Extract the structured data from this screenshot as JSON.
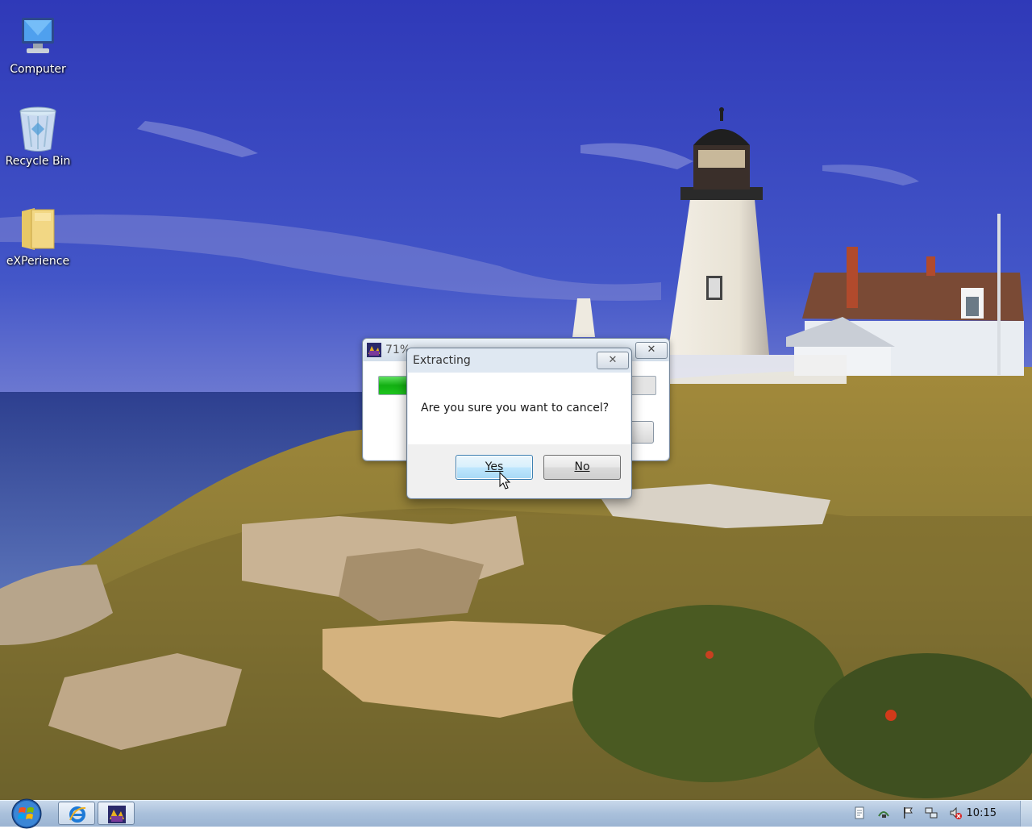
{
  "desktop": {
    "icons": [
      {
        "label": "Computer",
        "icon": "computer-icon"
      },
      {
        "label": "Recycle Bin",
        "icon": "recycle-bin-icon"
      },
      {
        "label": "eXPerience",
        "icon": "folder-icon"
      }
    ]
  },
  "progress_window": {
    "title": "71% ",
    "progress_fraction": 0.71,
    "close_symbol": "✕"
  },
  "confirm_dialog": {
    "title": "Extracting",
    "close_symbol": "✕",
    "message": "Are you sure you want to cancel?",
    "yes_label": "Yes",
    "no_label": "No"
  },
  "taskbar": {
    "start_icon": "windows-start-orb-icon",
    "pinned": [
      {
        "name": "internet-explorer-icon"
      },
      {
        "name": "extractor-app-icon"
      }
    ],
    "tray_icons": [
      "document-icon",
      "network-icon",
      "action-center-flag-icon",
      "network-connection-icon",
      "volume-muted-icon"
    ],
    "clock": "10:15"
  },
  "colors": {
    "progress_green": "#12b012",
    "taskbar": "#a9c0db",
    "sky": "#3a4fc4"
  }
}
